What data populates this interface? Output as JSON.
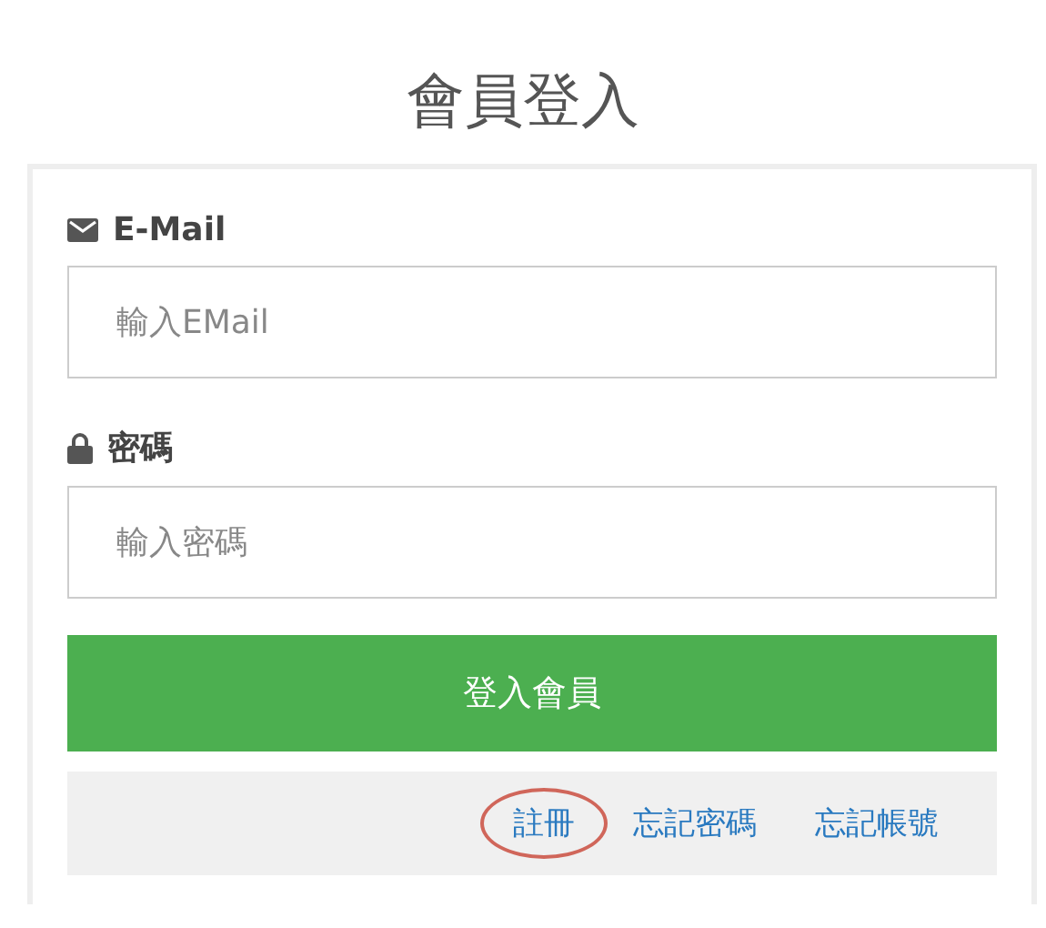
{
  "title": "會員登入",
  "fields": [
    {
      "kind": "email",
      "label": "E-Mail",
      "placeholder": "輸入EMail"
    },
    {
      "kind": "lock",
      "label": "密碼",
      "placeholder": "輸入密碼"
    }
  ],
  "submit": "登入會員",
  "links": [
    {
      "label": "註冊",
      "highlighted": true
    },
    {
      "label": "忘記密碼",
      "highlighted": false
    },
    {
      "label": "忘記帳號",
      "highlighted": false
    }
  ]
}
